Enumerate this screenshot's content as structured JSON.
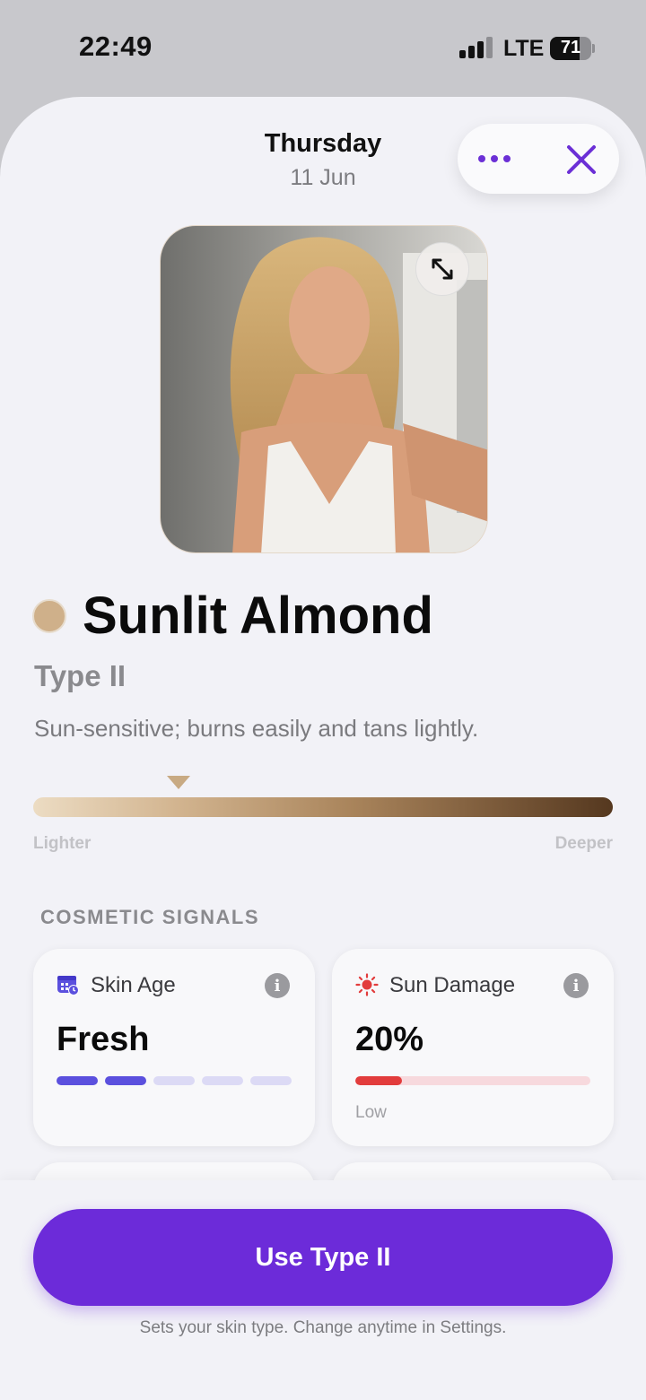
{
  "status_bar": {
    "time": "22:49",
    "network": "LTE",
    "battery": "71",
    "battery_level": 0.71
  },
  "header": {
    "day": "Thursday",
    "date": "11 Jun"
  },
  "icons": {
    "more": "more-dots-icon",
    "close": "close-x-icon",
    "expand": "expand-arrows-icon",
    "skin_age": "calendar-clock-icon",
    "sun_damage": "sun-icon",
    "info": "info-icon"
  },
  "result": {
    "swatch_color": "#cfb08a",
    "name": "Sunlit Almond",
    "type": "Type II",
    "description": "Sun-sensitive; burns easily and tans lightly."
  },
  "scale": {
    "lighter_label": "Lighter",
    "deeper_label": "Deeper",
    "position": 0.25
  },
  "signals": {
    "title": "COSMETIC SIGNALS",
    "skin_age": {
      "label": "Skin Age",
      "value": "Fresh",
      "info": "i",
      "segments_total": 5,
      "segments_filled": 2
    },
    "sun_damage": {
      "label": "Sun Damage",
      "value": "20%",
      "level": 0.2,
      "note": "Low",
      "info": "i"
    }
  },
  "cta": {
    "label": "Use Type II",
    "note": "Sets your skin type. Change anytime in Settings."
  },
  "colors": {
    "accent": "#6c2bd9",
    "segment_on": "#5b50de",
    "sun_bar": "#e23c3c"
  }
}
